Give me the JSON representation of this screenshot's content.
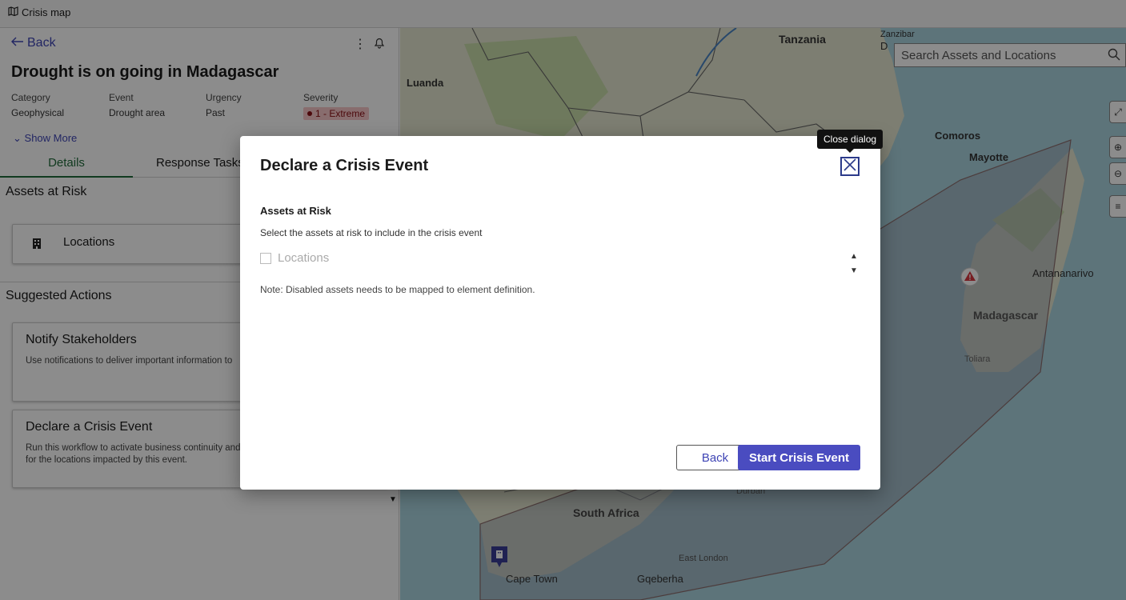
{
  "app": {
    "title": "Crisis map"
  },
  "left_panel": {
    "back_label": "Back",
    "event_title": "Drought is on going in Madagascar",
    "meta": [
      {
        "label": "Category",
        "value": "Geophysical"
      },
      {
        "label": "Event",
        "value": "Drought area"
      },
      {
        "label": "Urgency",
        "value": "Past"
      },
      {
        "label": "Severity",
        "value": "1 - Extreme"
      }
    ],
    "show_more": "Show More",
    "tabs": [
      {
        "label": "Details",
        "active": true
      },
      {
        "label": "Response Tasks",
        "active": false
      }
    ],
    "assets_heading": "Assets at Risk",
    "asset_card_label": "Locations",
    "suggested_heading": "Suggested Actions",
    "actions": [
      {
        "title": "Notify Stakeholders",
        "desc": "Use notifications to deliver important information to"
      },
      {
        "title": "Declare a Crisis Event",
        "desc": "Run this workflow to activate business continuity and\nfor the locations impacted by this event."
      }
    ]
  },
  "map": {
    "search_placeholder": "Search Assets and Locations",
    "labels": {
      "tanzania": "Tanzania",
      "zanzibar": "Zanzibar",
      "dodoma": "D",
      "luanda": "Luanda",
      "comoros": "Comoros",
      "mayotte": "Mayotte",
      "antananarivo": "Antananarivo",
      "madagascar": "Madagascar",
      "toliara": "Toliara",
      "durban": "Durban",
      "south_africa": "South Africa",
      "east_london": "East London",
      "cape_town": "Cape Town",
      "gqeberha": "Gqeberha"
    },
    "colors": {
      "water": "#a9d3df",
      "land": "#e4e6cf",
      "polygon": "#9aa0b0",
      "marker": "#3a3d95",
      "alert": "#d9363e"
    }
  },
  "dialog": {
    "title": "Declare a Crisis Event",
    "close_tooltip": "Close dialog",
    "section_heading": "Assets at Risk",
    "section_desc": "Select the assets at risk to include in the crisis event",
    "option_label": "Locations",
    "option_checked": false,
    "option_disabled": true,
    "note": "Note: Disabled assets needs to be mapped to element definition.",
    "back_button": "Back",
    "start_button": "Start Crisis Event"
  }
}
